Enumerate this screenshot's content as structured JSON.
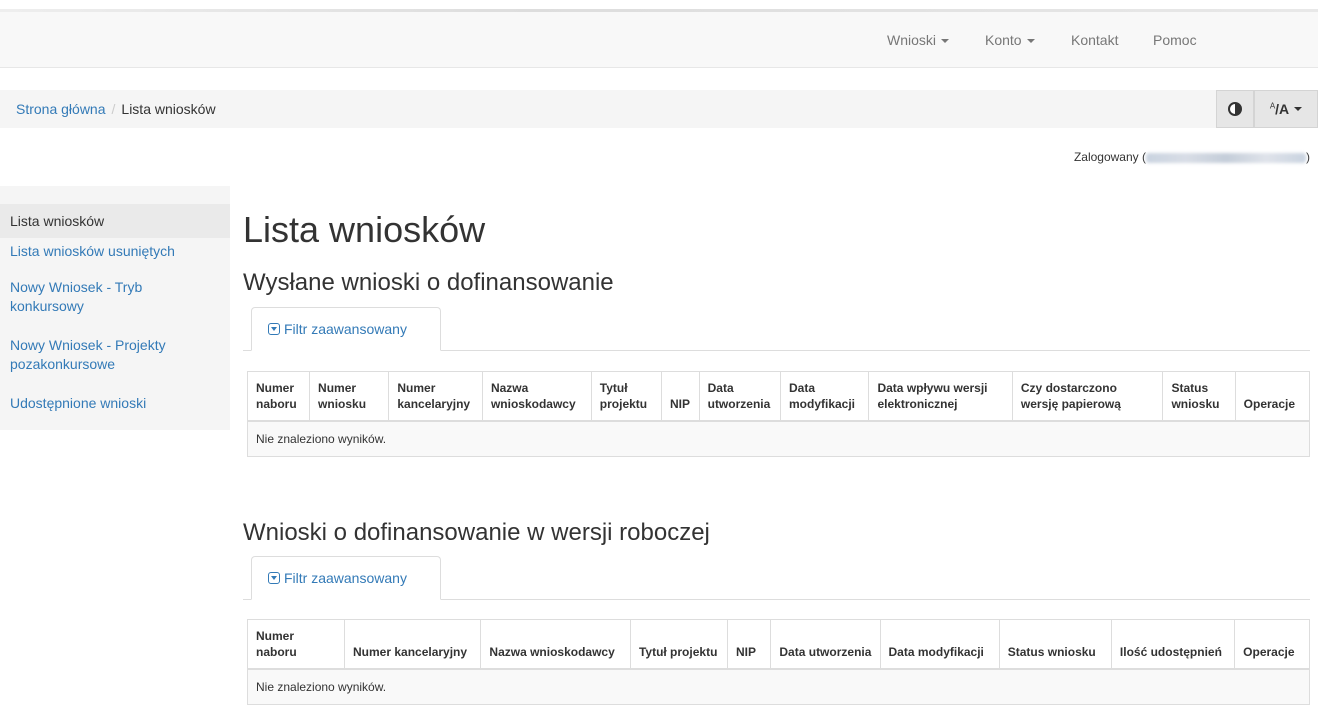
{
  "nav": {
    "items": [
      {
        "label": "Wnioski",
        "dropdown": true
      },
      {
        "label": "Konto",
        "dropdown": true
      },
      {
        "label": "Kontakt",
        "dropdown": false
      },
      {
        "label": "Pomoc",
        "dropdown": false
      }
    ]
  },
  "breadcrumb": {
    "home": "Strona główna",
    "separator": "/",
    "current": "Lista wniosków"
  },
  "toolbar": {
    "contrast_icon": "contrast-icon",
    "font_size_icon": "font-size-icon"
  },
  "user": {
    "logged_prefix": "Zalogowany (",
    "logged_suffix": ")"
  },
  "sidebar": {
    "items": [
      {
        "label": "Lista wniosków",
        "active": true
      },
      {
        "label": "Lista wniosków usuniętych",
        "active": false
      },
      {
        "label": "Nowy Wniosek - Tryb konkursowy",
        "active": false
      },
      {
        "label": "Nowy Wniosek - Projekty pozakonkursowe",
        "active": false
      },
      {
        "label": "Udostępnione wnioski",
        "active": false
      }
    ]
  },
  "main": {
    "title": "Lista wniosków",
    "sections": [
      {
        "heading": "Wysłane wnioski o dofinansowanie",
        "filter_label": "Filtr zaawansowany",
        "columns": [
          "Numer naboru",
          "Numer wniosku",
          "Numer kancelaryjny",
          "Nazwa wnioskodawcy",
          "Tytuł projektu",
          "NIP",
          "Data utworzenia",
          "Data modyfikacji",
          "Data wpływu wersji elektronicznej",
          "Czy dostarczono wersję papierową",
          "Status wniosku",
          "Operacje"
        ],
        "empty_message": "Nie znaleziono wyników."
      },
      {
        "heading": "Wnioski o dofinansowanie w wersji roboczej",
        "filter_label": "Filtr zaawansowany",
        "columns": [
          "Numer naboru",
          "Numer kancelaryjny",
          "Nazwa wnioskodawcy",
          "Tytuł projektu",
          "NIP",
          "Data utworzenia",
          "Data modyfikacji",
          "Status wniosku",
          "Ilość udostępnień",
          "Operacje"
        ],
        "empty_message": "Nie znaleziono wyników."
      }
    ]
  }
}
